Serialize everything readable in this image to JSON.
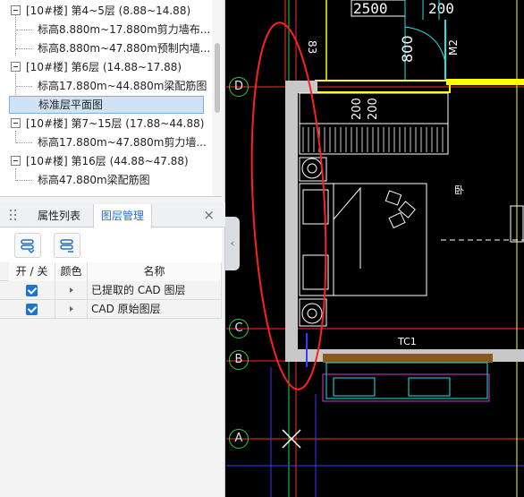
{
  "tree": {
    "items": [
      {
        "kind": "group",
        "label": "[10#楼] 第4~5层 (8.88~14.88)"
      },
      {
        "kind": "child",
        "label": "标高8.880m~17.880m剪力墙布..."
      },
      {
        "kind": "child",
        "label": "标高8.880m~47.880m预制内墙..."
      },
      {
        "kind": "group",
        "label": "[10#楼] 第6层 (14.88~17.88)"
      },
      {
        "kind": "child",
        "label": "标高17.880m~44.880m梁配筋图"
      },
      {
        "kind": "child",
        "label": "标准层平面图",
        "selected": true
      },
      {
        "kind": "group",
        "label": "[10#楼] 第7~15层 (17.88~44.88)"
      },
      {
        "kind": "child",
        "label": "标高17.880m~47.880m剪力墙..."
      },
      {
        "kind": "group",
        "label": "[10#楼] 第16层 (44.88~47.88)"
      },
      {
        "kind": "child",
        "label": "标高47.880m梁配筋图"
      }
    ]
  },
  "tabs": {
    "attr_label": "属性列表",
    "layer_label": "图层管理",
    "close_glyph": "×",
    "active": "图层管理"
  },
  "layers": {
    "headers": {
      "toggle": "开 / 关",
      "color": "颜色",
      "name": "名称"
    },
    "rows": [
      {
        "checked": true,
        "name": "已提取的 CAD 图层"
      },
      {
        "checked": true,
        "name": "CAD 原始图层"
      }
    ]
  },
  "collapse_glyph": "‹",
  "cad": {
    "dimension_text": "2500",
    "dimension_text_2": "200",
    "vertical_dims": [
      "800",
      "200",
      "200"
    ],
    "small_labels": [
      "83",
      "M2",
      "卧",
      "TC1"
    ],
    "axis_labels": [
      "D",
      "C",
      "B",
      "A"
    ],
    "colors": {
      "wall": "#c8c8c8",
      "yellow": "#ffff00",
      "red": "#ff2a2a",
      "cyan": "#22e3e3",
      "green": "#2ed13c",
      "white": "#ffffff",
      "brown": "#8b5a1b",
      "magenta": "#d13cd1"
    }
  }
}
